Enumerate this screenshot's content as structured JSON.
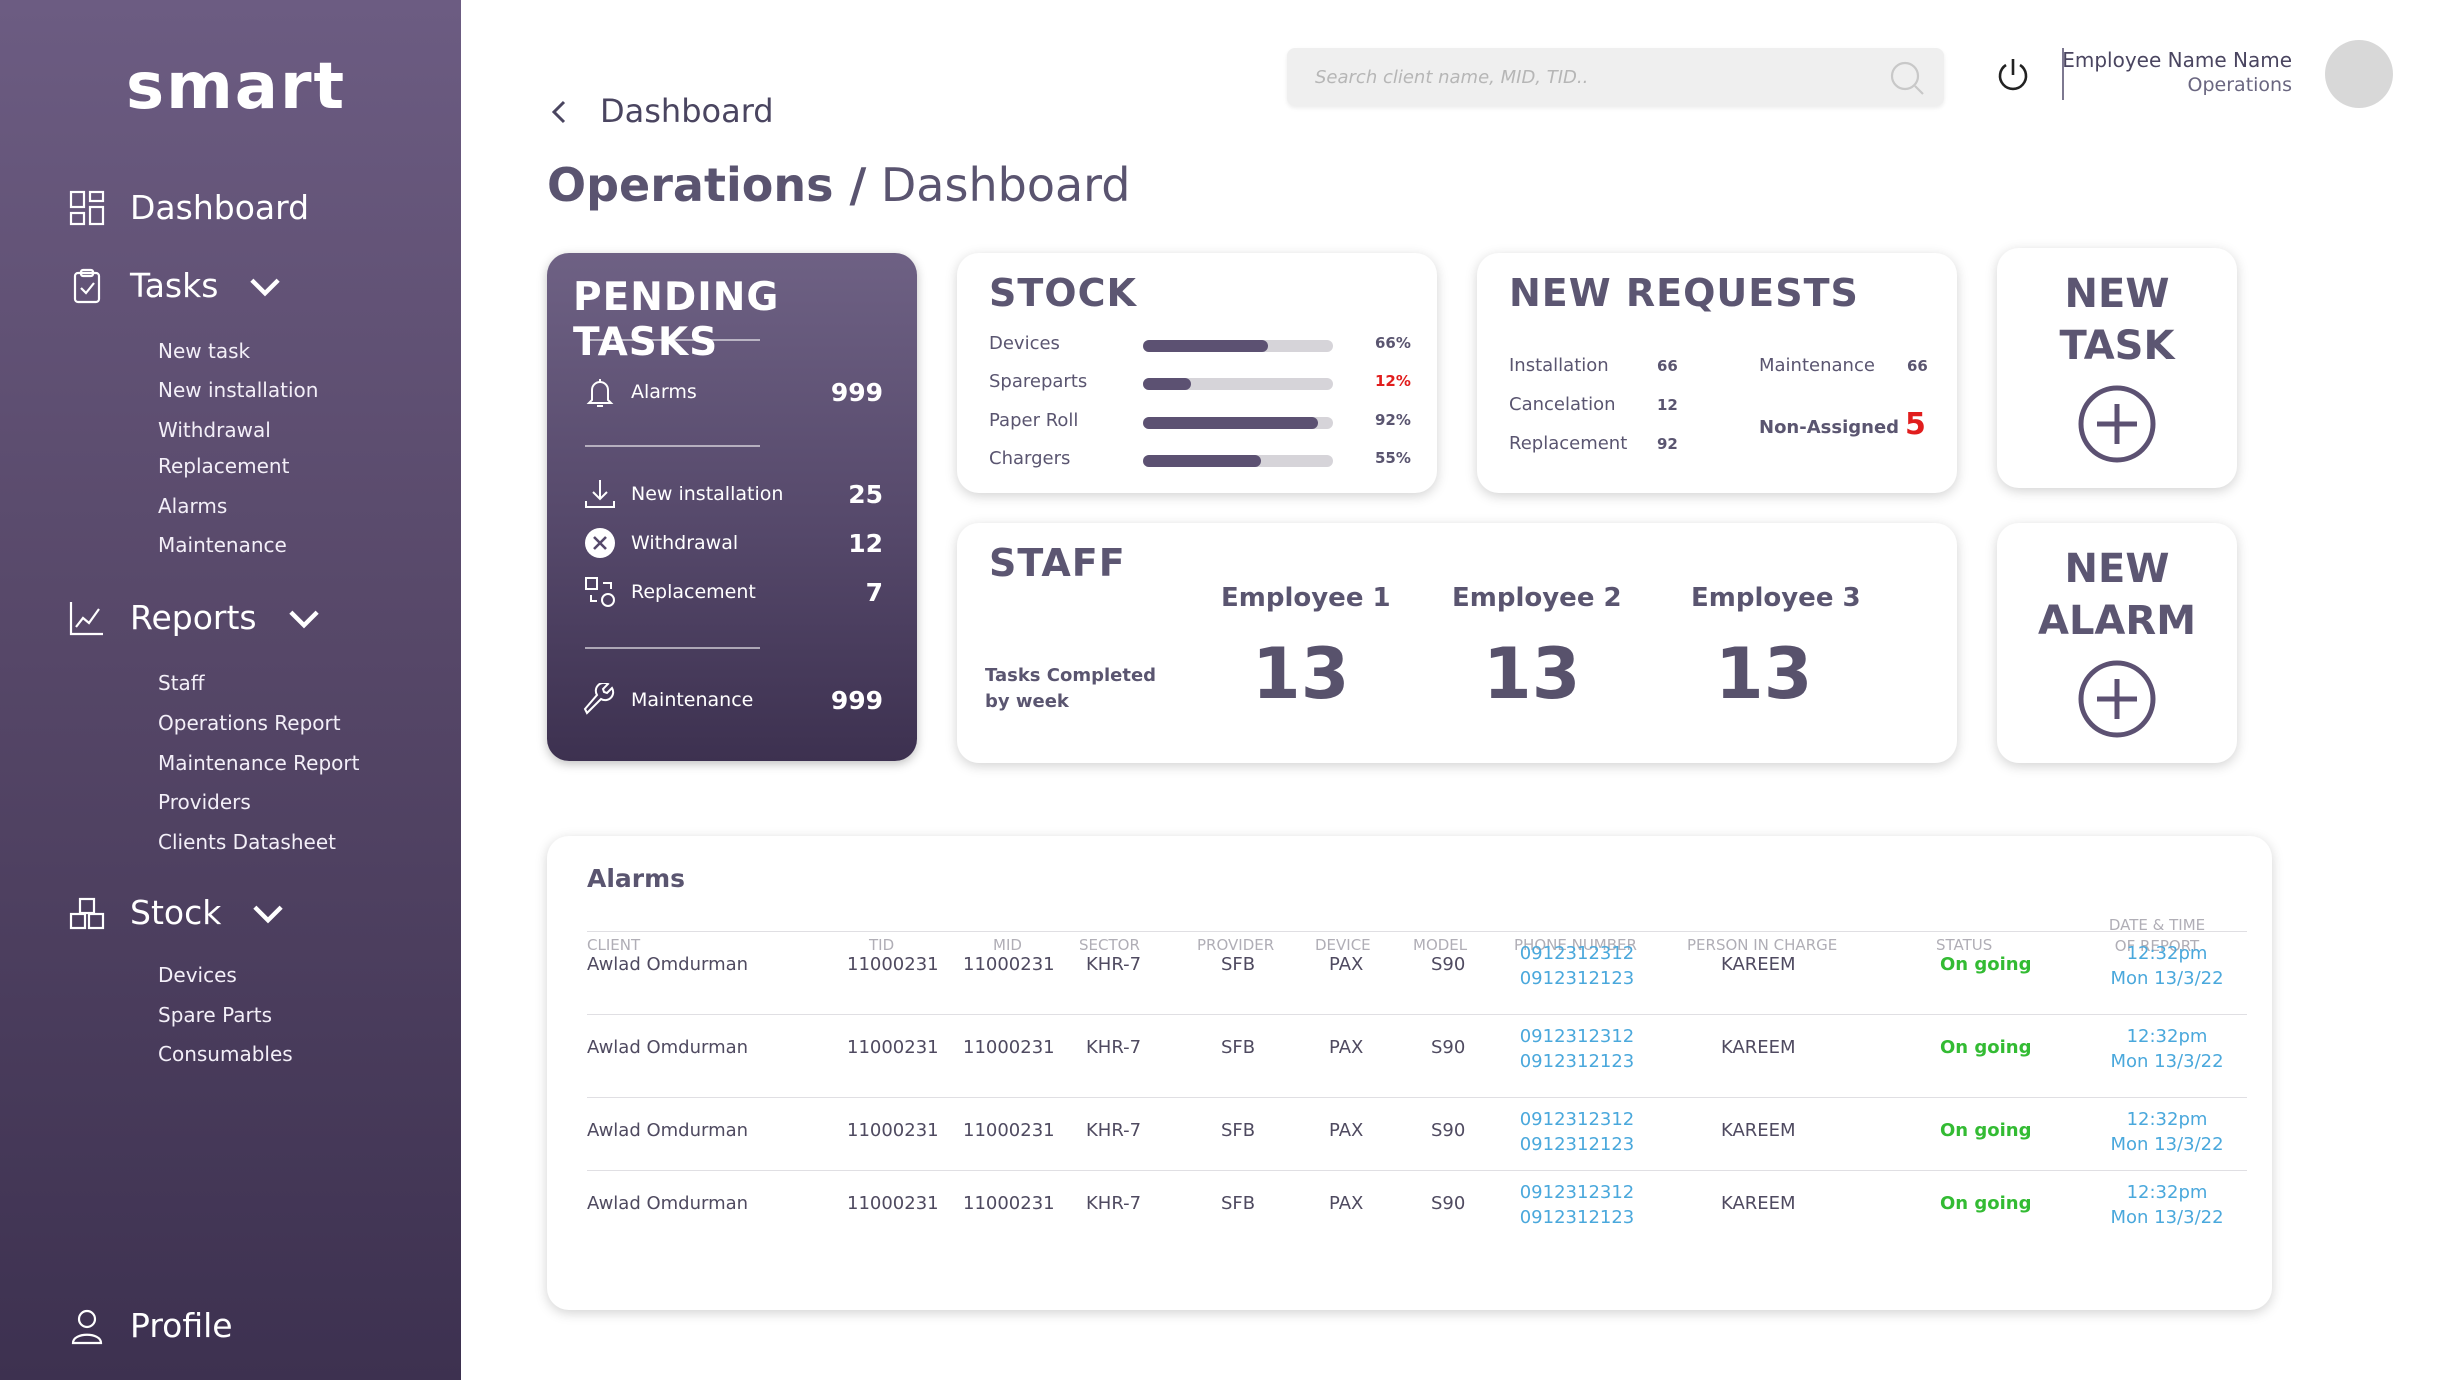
{
  "sidebar": {
    "logo": "smart",
    "dashboard": "Dashboard",
    "tasks": "Tasks",
    "tasks_items": [
      "New task",
      "New installation",
      "Withdrawal",
      "Replacement",
      "Alarms",
      "Maintenance"
    ],
    "reports": "Reports",
    "reports_items": [
      "Staff",
      "Operations Report",
      "Maintenance Report",
      "Providers",
      "Clients Datasheet"
    ],
    "stock": "Stock",
    "stock_items": [
      "Devices",
      "Spare Parts",
      "Consumables"
    ],
    "profile": "Profile"
  },
  "header": {
    "search_placeholder": "Search client name, MID, TID..",
    "user_name": "Employee Name Name",
    "user_role": "Operations",
    "breadcrumb": "Dashboard",
    "title_bold": "Operations /",
    "title_rest": "Dashboard"
  },
  "pending": {
    "title": "PENDING TASKS",
    "alarms_label": "Alarms",
    "alarms_value": "999",
    "install_label": "New installation",
    "install_value": "25",
    "withdrawal_label": "Withdrawal",
    "withdrawal_value": "12",
    "replacement_label": "Replacement",
    "replacement_value": "7",
    "maintenance_label": "Maintenance",
    "maintenance_value": "999"
  },
  "stock": {
    "title": "STOCK",
    "items": [
      {
        "label": "Devices",
        "pct": "66%",
        "level": 66,
        "alert": false
      },
      {
        "label": "Spareparts",
        "pct": "12%",
        "level": 25,
        "alert": true
      },
      {
        "label": "Paper Roll",
        "pct": "92%",
        "level": 92,
        "alert": false
      },
      {
        "label": "Chargers",
        "pct": "55%",
        "level": 62,
        "alert": false
      }
    ]
  },
  "requests": {
    "title": "NEW REQUESTS",
    "installation": "Installation",
    "installation_value": "66",
    "cancelation": "Cancelation",
    "cancelation_value": "12",
    "replacement": "Replacement",
    "replacement_value": "92",
    "maintenance": "Maintenance",
    "maintenance_value": "66",
    "non_assigned": "Non-Assigned",
    "non_assigned_value": "5"
  },
  "staff": {
    "title": "STAFF",
    "caption_line1": "Tasks Completed",
    "caption_line2": "by week",
    "employees": [
      {
        "name": "Employee 1",
        "value": "13"
      },
      {
        "name": "Employee 2",
        "value": "13"
      },
      {
        "name": "Employee 3",
        "value": "13"
      }
    ]
  },
  "new_task": {
    "line1": "NEW",
    "line2": "TASK"
  },
  "new_alarm": {
    "line1": "NEW",
    "line2": "ALARM"
  },
  "alarms": {
    "title": "Alarms",
    "columns": [
      "CLIENT",
      "TID",
      "MID",
      "SECTOR",
      "PROVIDER",
      "DEVICE",
      "MODEL",
      "PHONE NUMBER",
      "PERSON IN CHARGE",
      "STATUS",
      "DATE & TIME",
      "OF REPORT"
    ],
    "rows": [
      {
        "client": "Awlad Omdurman",
        "tid": "11000231",
        "mid": "11000231",
        "sector": "KHR-7",
        "provider": "SFB",
        "device": "PAX",
        "model": "S90",
        "phone1": "0912312312",
        "phone2": "0912312123",
        "person": "KAREEM",
        "status": "On going",
        "time": "12:32pm",
        "date": "Mon 13/3/22"
      },
      {
        "client": "Awlad Omdurman",
        "tid": "11000231",
        "mid": "11000231",
        "sector": "KHR-7",
        "provider": "SFB",
        "device": "PAX",
        "model": "S90",
        "phone1": "0912312312",
        "phone2": "0912312123",
        "person": "KAREEM",
        "status": "On going",
        "time": "12:32pm",
        "date": "Mon 13/3/22"
      },
      {
        "client": "Awlad Omdurman",
        "tid": "11000231",
        "mid": "11000231",
        "sector": "KHR-7",
        "provider": "SFB",
        "device": "PAX",
        "model": "S90",
        "phone1": "0912312312",
        "phone2": "0912312123",
        "person": "KAREEM",
        "status": "On going",
        "time": "12:32pm",
        "date": "Mon 13/3/22"
      },
      {
        "client": "Awlad Omdurman",
        "tid": "11000231",
        "mid": "11000231",
        "sector": "KHR-7",
        "provider": "SFB",
        "device": "PAX",
        "model": "S90",
        "phone1": "0912312312",
        "phone2": "0912312123",
        "person": "KAREEM",
        "status": "On going",
        "time": "12:32pm",
        "date": "Mon 13/3/22"
      }
    ]
  },
  "colors": {
    "accent": "#5c5172",
    "status_green": "#33bb33",
    "phone_blue": "#4aa8dc",
    "alert_red": "#e11d1d"
  }
}
